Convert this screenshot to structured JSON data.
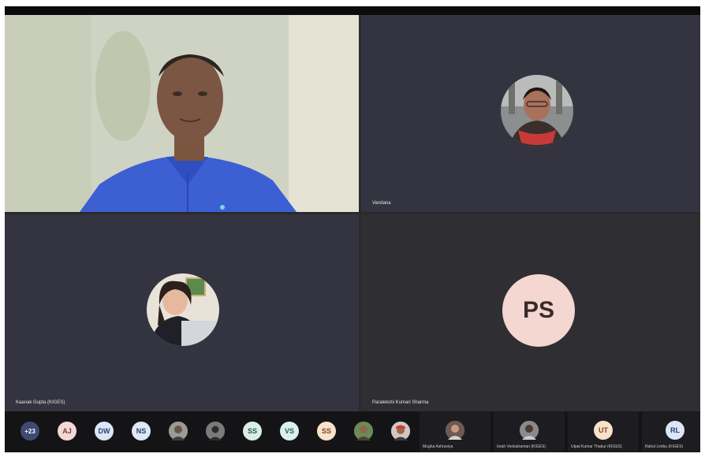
{
  "tiles": [
    {
      "name": ""
    },
    {
      "name": "Vandana"
    },
    {
      "name": "Kaanak Gupta (KIGES)"
    },
    {
      "name": "Paralekshi Kumari Sharma",
      "initials": "PS"
    }
  ],
  "strip": {
    "more_count": "+23",
    "chips": [
      "AJ",
      "DW",
      "NS",
      "SS",
      "VS",
      "SS"
    ],
    "cards": [
      {
        "name": "Mugha Ashraviya",
        "initials": ""
      },
      {
        "name": "Israh Venkatraman (KIGES)",
        "initials": ""
      },
      {
        "name": "Utpal Kumar Thakur (KIGES)",
        "initials": "UT"
      },
      {
        "name": "Rahul Limbu (KIGES)",
        "initials": "RL"
      }
    ]
  },
  "colors": {
    "stage": "#2a2a2e",
    "tile_dark": "#33343f",
    "ps_avatar": "#f4d7d1",
    "chip_more": "#3f4a72",
    "chip_aj": "#f3d9d6",
    "chip_dw": "#dbe6f7",
    "chip_ns": "#dfe8f5",
    "chip_ss": "#d9efe6",
    "chip_vs": "#d9f1ee",
    "chip_ss2": "#f8e2cc"
  }
}
